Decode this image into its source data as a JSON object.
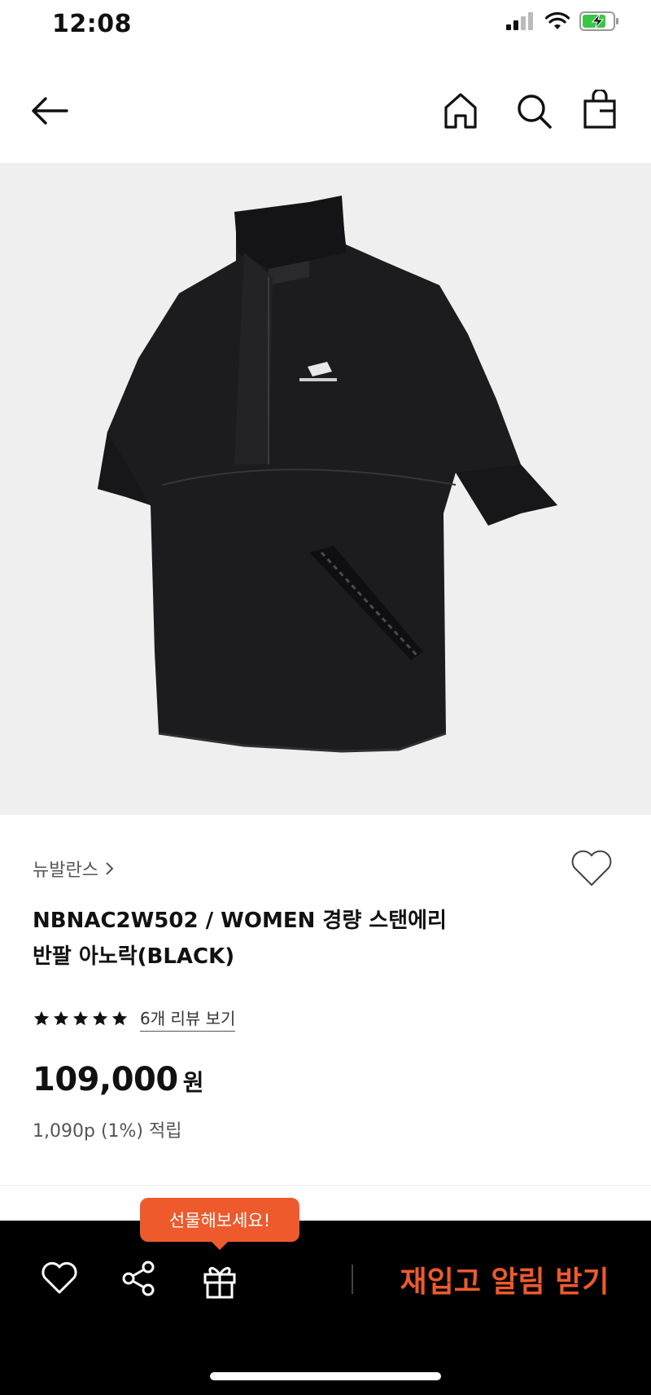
{
  "status_bar": {
    "time": "12:08",
    "icons": [
      "signal-icon",
      "wifi-icon",
      "battery-charging-icon"
    ]
  },
  "nav": {
    "icons": [
      "back-arrow-icon",
      "home-icon",
      "search-icon",
      "shopping-bag-icon"
    ]
  },
  "product": {
    "brand": "뉴발란스",
    "title_line1": "NBNAC2W502 / WOMEN 경량 스탠에리",
    "title_line2": "반팔 아노락(BLACK)",
    "rating_stars": 5,
    "review_link": "6개 리뷰 보기",
    "price": "109,000",
    "price_unit": "원",
    "points": "1,090p (1%) 적립",
    "image_description_icon": "black-short-sleeve-anorak-image"
  },
  "bottom_bar": {
    "gift_tooltip": "선물해보세요!",
    "restock_button": "재입고 알림 받기",
    "icons": [
      "heart-icon",
      "share-icon",
      "gift-icon"
    ]
  },
  "colors": {
    "accent": "#ee5a2c",
    "bottom_bar_bg": "#000000",
    "image_bg": "#efefef"
  }
}
